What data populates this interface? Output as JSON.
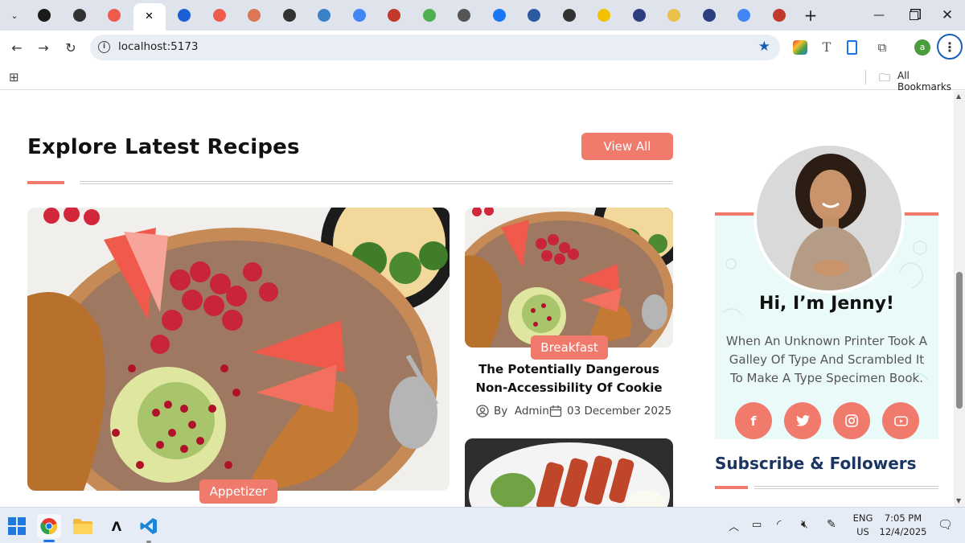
{
  "browser": {
    "url": "localhost:5173",
    "bookmarks_label": "All Bookmarks",
    "profile_initial": "a",
    "tabs": [
      {
        "icon": "app-icon",
        "color": "#1a1a1a"
      },
      {
        "icon": "openai-icon",
        "color": "#333333"
      },
      {
        "icon": "pdf-tool-icon",
        "color": "#ef5b4b"
      },
      {
        "icon": "current-tab-icon",
        "color": "#ffffff"
      },
      {
        "icon": "play-icon",
        "color": "#1a5fd6"
      },
      {
        "icon": "pdf-tool-icon",
        "color": "#ef5b4b"
      },
      {
        "icon": "claude-icon",
        "color": "#d97757"
      },
      {
        "icon": "github-icon",
        "color": "#333333"
      },
      {
        "icon": "globe-icon",
        "color": "#3b82c4"
      },
      {
        "icon": "google-icon",
        "color": "#4285f4"
      },
      {
        "icon": "swirl-icon",
        "color": "#c0392b"
      },
      {
        "icon": "ai-icon",
        "color": "#4caf50"
      },
      {
        "icon": "globe-icon",
        "color": "#555555"
      },
      {
        "icon": "facebook-icon",
        "color": "#1877f2"
      },
      {
        "icon": "history-icon",
        "color": "#2c5aa0"
      },
      {
        "icon": "github-icon",
        "color": "#333333"
      },
      {
        "icon": "game-icon",
        "color": "#f2c200"
      },
      {
        "icon": "book-icon",
        "color": "#2c3e80"
      },
      {
        "icon": "moon-icon",
        "color": "#e8c04a"
      },
      {
        "icon": "book-icon",
        "color": "#2c3e80"
      },
      {
        "icon": "google-icon",
        "color": "#4285f4"
      },
      {
        "icon": "swirl-icon",
        "color": "#c0392b"
      }
    ]
  },
  "page": {
    "section_title": "Explore Latest Recipes",
    "view_all_label": "View All",
    "main_card": {
      "badge": "Appetizer"
    },
    "side_card": {
      "badge": "Breakfast",
      "title": "The Potentially Dangerous Non-Accessibility Of Cookie",
      "author": "By  Admin",
      "date": "03 December 2025"
    },
    "profile": {
      "greeting": "Hi, I’m Jenny!",
      "bio": "When An Unknown Printer Took A Galley Of Type And Scrambled It To Make A Type Specimen Book."
    },
    "socials": [
      "facebook-icon",
      "twitter-icon",
      "instagram-icon",
      "youtube-icon"
    ],
    "subscribe_title": "Subscribe & Followers"
  },
  "colors": {
    "accent": "#f07a6c",
    "profile_bg": "#eafaf9",
    "heading_navy": "#1a3561"
  },
  "taskbar": {
    "lang": "ENG",
    "region": "US",
    "time": "7:05 PM",
    "date": "12/4/2025"
  }
}
